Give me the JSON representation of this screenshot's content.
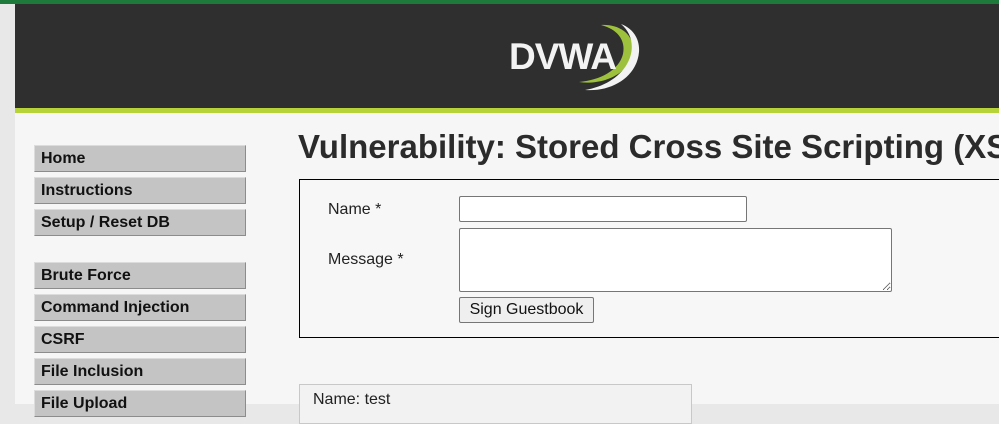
{
  "header": {
    "logo_text": "DVWA",
    "colors": {
      "bar": "#2f2f2f",
      "accent": "#b6d33a",
      "top_line": "#1e7a3a"
    }
  },
  "sidebar": {
    "group1": [
      {
        "label": "Home"
      },
      {
        "label": "Instructions"
      },
      {
        "label": "Setup / Reset DB"
      }
    ],
    "group2": [
      {
        "label": "Brute Force"
      },
      {
        "label": "Command Injection"
      },
      {
        "label": "CSRF"
      },
      {
        "label": "File Inclusion"
      },
      {
        "label": "File Upload"
      }
    ]
  },
  "main": {
    "title": "Vulnerability: Stored Cross Site Scripting (XSS)",
    "form": {
      "name_label": "Name *",
      "name_value": "",
      "message_label": "Message *",
      "message_value": "",
      "submit_label": "Sign Guestbook"
    },
    "entries": [
      {
        "name_line": "Name: test"
      }
    ]
  }
}
